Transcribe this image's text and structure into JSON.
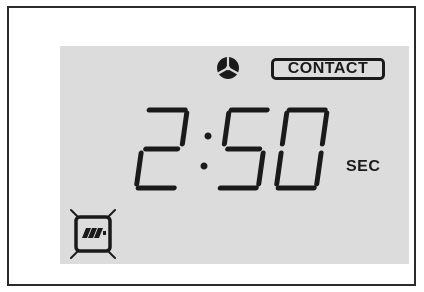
{
  "display": {
    "status_badge": "CONTACT",
    "time_value": "2:50",
    "time_unit": "SEC",
    "indicators": {
      "fan_icon": "fan-icon",
      "battery_icon": "battery-low-icon"
    },
    "colors": {
      "lcd_background": "#dcdcdc",
      "segment": "#1a1a1a",
      "frame": "#2b2b2b"
    }
  }
}
